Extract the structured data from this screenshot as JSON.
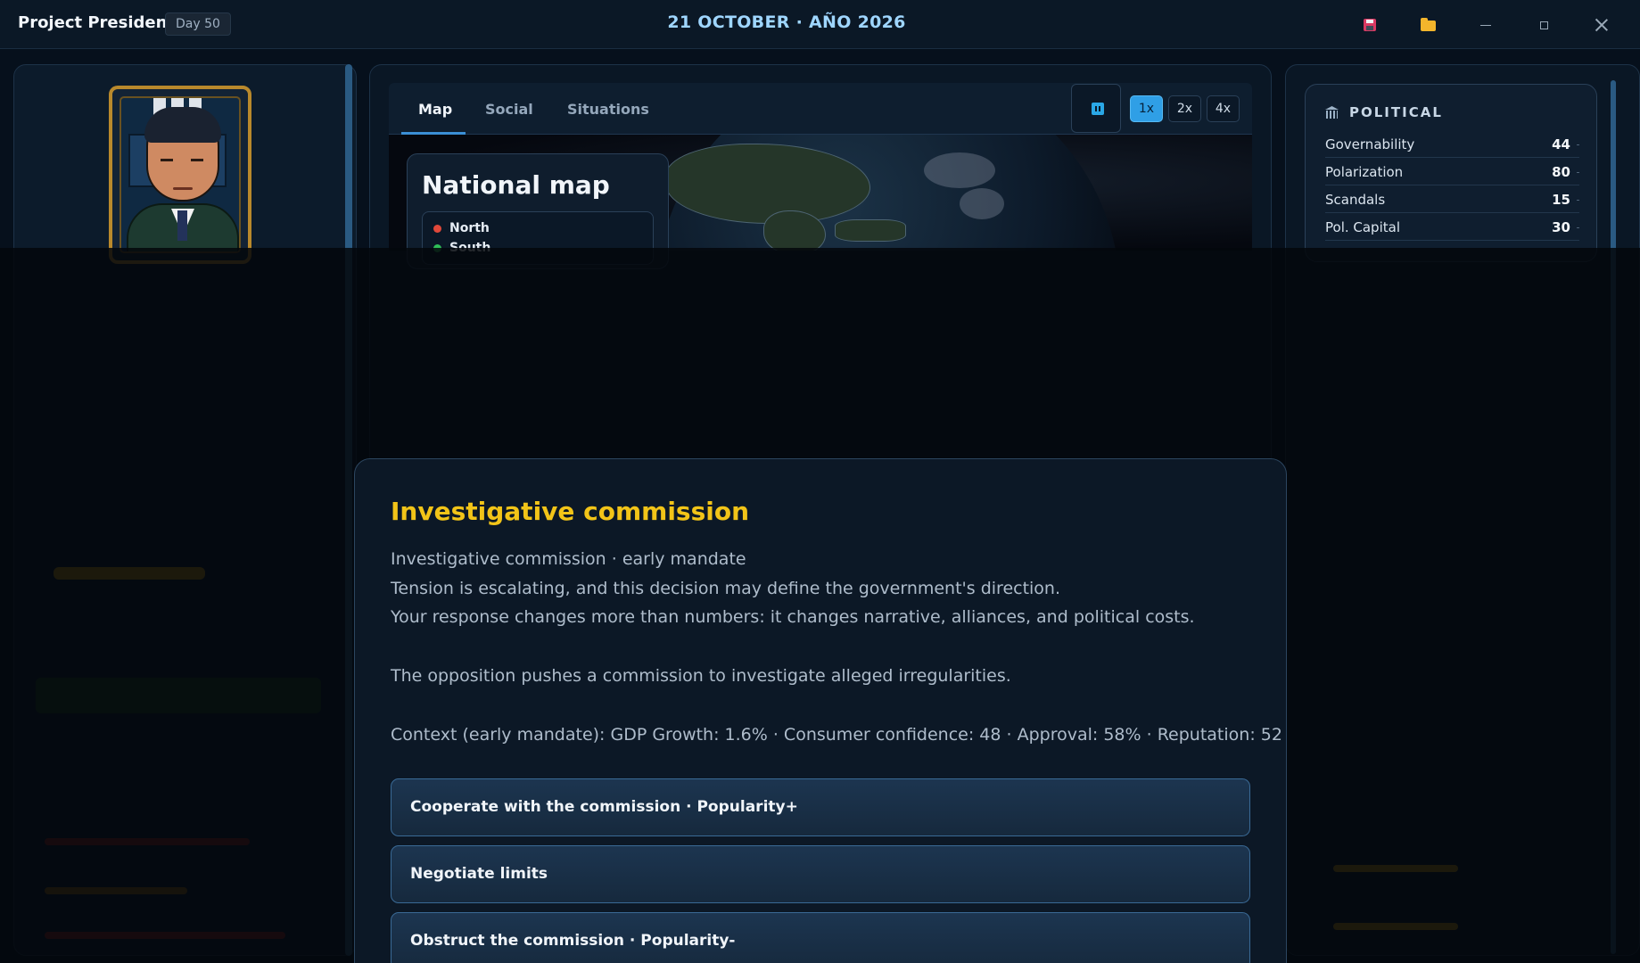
{
  "titlebar": {
    "app_title": "Project President",
    "day_badge": "Day 50",
    "date": "21 OCTOBER · AÑO 2026",
    "icons": [
      "save-icon",
      "folder-icon",
      "minimize-icon",
      "maximize-icon",
      "close-icon"
    ]
  },
  "main": {
    "tabs": [
      {
        "label": "Map"
      },
      {
        "label": "Social"
      },
      {
        "label": "Situations"
      }
    ],
    "active_tab": "Map",
    "speeds": [
      "1x",
      "2x",
      "4x"
    ],
    "active_speed": "1x",
    "map_card": {
      "title": "National map",
      "legend": [
        {
          "label": "North",
          "color": "#e0483a"
        },
        {
          "label": "South",
          "color": "#2fbf58"
        }
      ]
    }
  },
  "political": {
    "title": "POLITICAL",
    "stats": [
      {
        "label": "Governability",
        "value": "44"
      },
      {
        "label": "Polarization",
        "value": "80"
      },
      {
        "label": "Scandals",
        "value": "15"
      },
      {
        "label": "Pol. Capital",
        "value": "30"
      }
    ]
  },
  "modal": {
    "title": "Investigative commission",
    "lines": [
      "Investigative commission · early mandate",
      "Tension is escalating, and this decision may define the government's direction.",
      "Your response changes more than numbers: it changes narrative, alliances, and political costs.",
      "The opposition pushes a commission to investigate alleged irregularities.",
      "Context (early mandate): GDP Growth: 1.6% · Consumer confidence: 48 · Approval: 58% · Reputation: 52"
    ],
    "choices": [
      {
        "label": "Cooperate with the commission · Popularity+"
      },
      {
        "label": "Negotiate limits"
      },
      {
        "label": "Obstruct the commission · Popularity-"
      }
    ]
  },
  "colors": {
    "accent": "#3b8fd6",
    "modal_title": "#f2c418",
    "speed_active": "#2f9fe6"
  }
}
